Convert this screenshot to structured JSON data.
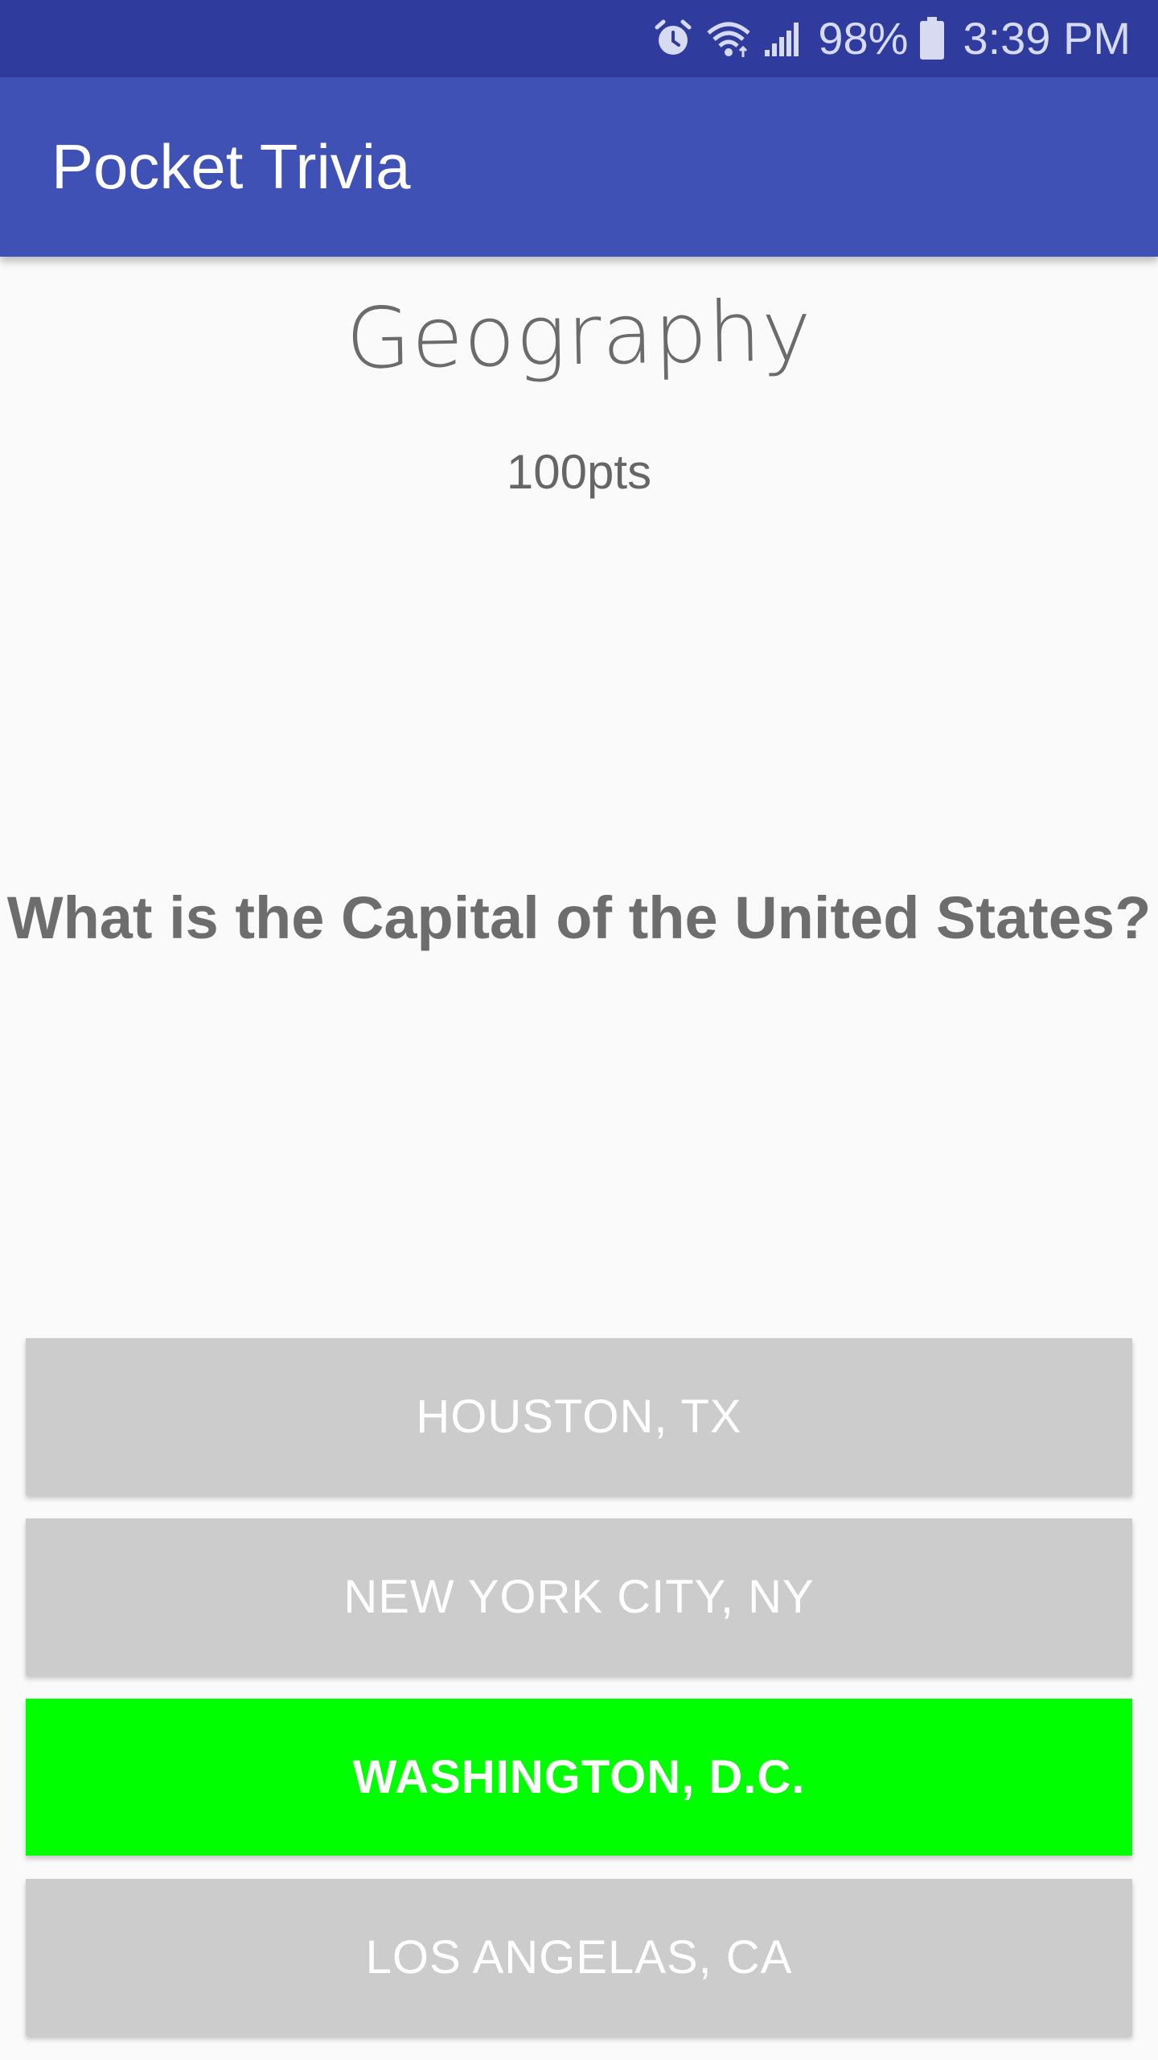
{
  "status_bar": {
    "battery_percent": "98%",
    "time": "3:39 PM",
    "icons": [
      "alarm-icon",
      "wifi-icon",
      "signal-icon",
      "battery-icon"
    ]
  },
  "app_bar": {
    "title": "Pocket Trivia"
  },
  "quiz": {
    "category": "Geography",
    "points": "100pts",
    "question": "What is the Capital of the United States?",
    "answers": [
      {
        "label": "HOUSTON, TX",
        "state": "neutral"
      },
      {
        "label": "NEW YORK CITY, NY",
        "state": "neutral"
      },
      {
        "label": "WASHINGTON, D.C.",
        "state": "correct"
      },
      {
        "label": "LOS ANGELAS, CA",
        "state": "neutral"
      }
    ]
  },
  "colors": {
    "status_bar": "#2f3c9e",
    "app_bar": "#3f51b5",
    "answer_neutral": "#cccccc",
    "answer_correct": "#00ff00",
    "background": "#fafafa"
  }
}
